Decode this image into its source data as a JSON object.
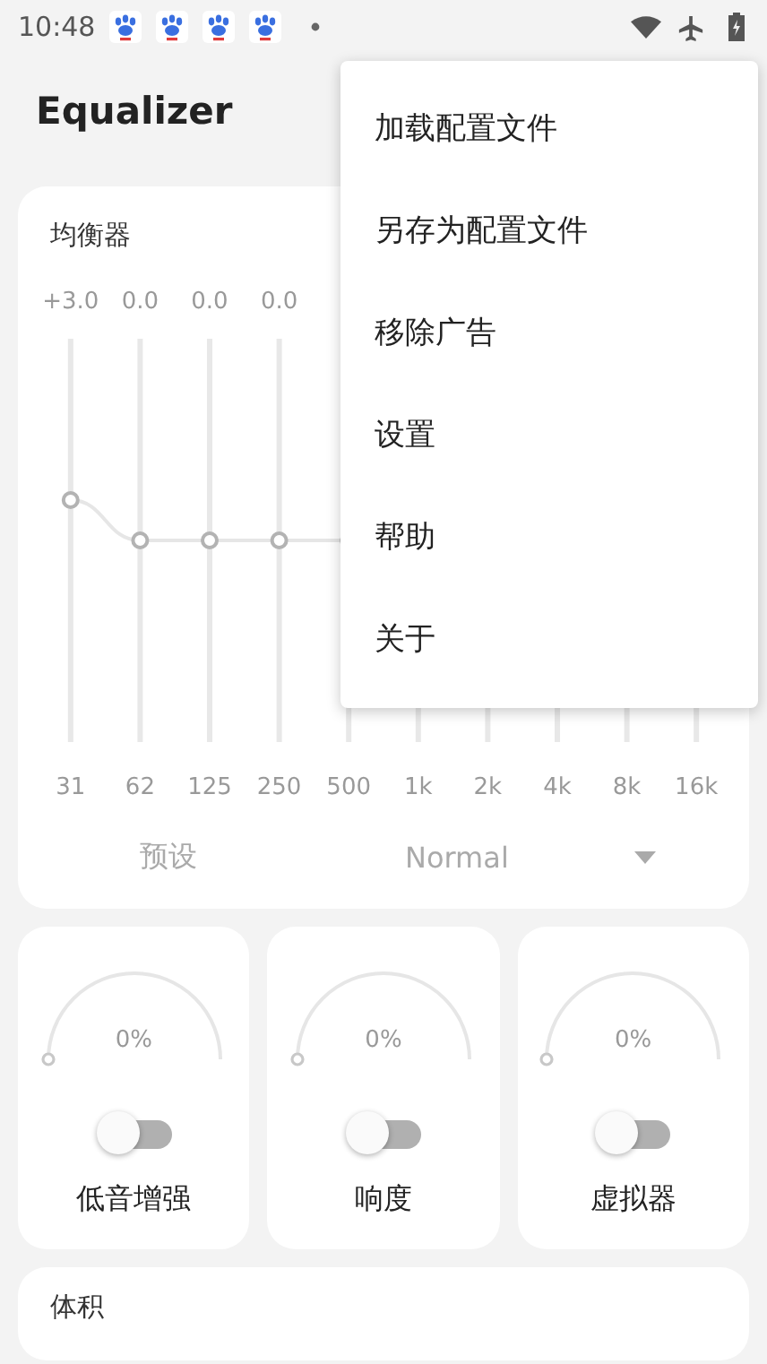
{
  "status_bar": {
    "time": "10:48"
  },
  "app_bar": {
    "title": "Equalizer"
  },
  "equalizer": {
    "title": "均衡器",
    "bands": [
      {
        "gain": "+3.0",
        "frequency": "31",
        "level": 0.6
      },
      {
        "gain": "0.0",
        "frequency": "62",
        "level": 0.5
      },
      {
        "gain": "0.0",
        "frequency": "125",
        "level": 0.5
      },
      {
        "gain": "0.0",
        "frequency": "250",
        "level": 0.5
      },
      {
        "frequency": "500",
        "level": 0.5
      },
      {
        "frequency": "1k"
      },
      {
        "frequency": "2k"
      },
      {
        "frequency": "4k"
      },
      {
        "frequency": "8k"
      },
      {
        "frequency": "16k"
      }
    ],
    "preset_label": "预设",
    "preset": "Normal"
  },
  "effects": [
    {
      "name": "低音增强",
      "value": "0%",
      "level": 0,
      "on": false
    },
    {
      "name": "响度",
      "value": "0%",
      "level": 0,
      "on": false
    },
    {
      "name": "虚拟器",
      "value": "0%",
      "level": 0,
      "on": false
    }
  ],
  "volume_card": {
    "title": "体积"
  },
  "menu": {
    "items": [
      "加载配置文件",
      "另存为配置文件",
      "移除广告",
      "设置",
      "帮助",
      "关于"
    ]
  }
}
